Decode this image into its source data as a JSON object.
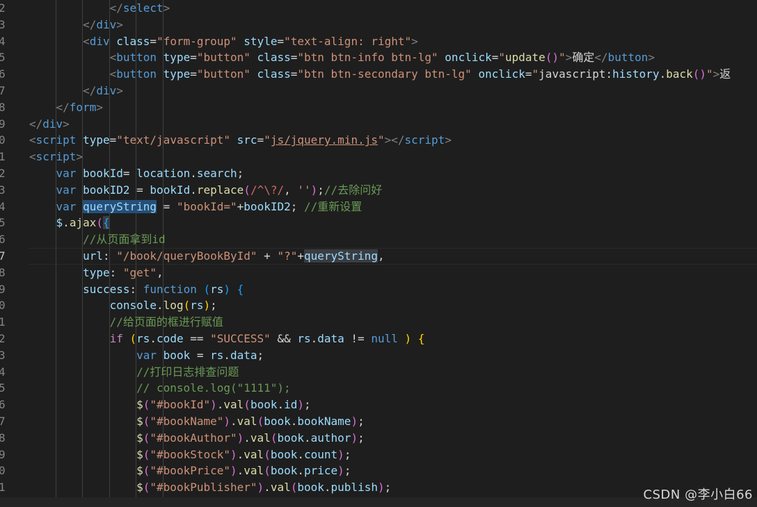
{
  "editor": {
    "theme_colors": {
      "background": "#1e1e1e",
      "tag": "#569cd6",
      "attribute": "#9cdcfe",
      "string": "#ce9178",
      "comment": "#6a9955",
      "function": "#dcdcaa",
      "control": "#c586c0"
    },
    "lines": [
      {
        "n": "2",
        "cls": "",
        "indent": "            ",
        "spans": [
          [
            "punc",
            "</"
          ],
          [
            "tag",
            "select"
          ],
          [
            "punc",
            ">"
          ]
        ]
      },
      {
        "n": "3",
        "cls": "",
        "indent": "        ",
        "spans": [
          [
            "punc",
            "</"
          ],
          [
            "tag",
            "div"
          ],
          [
            "punc",
            ">"
          ]
        ]
      },
      {
        "n": "4",
        "cls": "",
        "indent": "        ",
        "spans": [
          [
            "punc",
            "<"
          ],
          [
            "tag",
            "div"
          ],
          [
            "txt",
            " "
          ],
          [
            "attr",
            "class"
          ],
          [
            "txt",
            "="
          ],
          [
            "str",
            "\"form-group\""
          ],
          [
            "txt",
            " "
          ],
          [
            "attr",
            "style"
          ],
          [
            "txt",
            "="
          ],
          [
            "str",
            "\"text-align: right\""
          ],
          [
            "punc",
            ">"
          ]
        ]
      },
      {
        "n": "5",
        "cls": "",
        "indent": "            ",
        "spans": [
          [
            "punc",
            "<"
          ],
          [
            "tag",
            "button"
          ],
          [
            "txt",
            " "
          ],
          [
            "attr",
            "type"
          ],
          [
            "txt",
            "="
          ],
          [
            "str",
            "\"button\""
          ],
          [
            "txt",
            " "
          ],
          [
            "attr",
            "class"
          ],
          [
            "txt",
            "="
          ],
          [
            "str",
            "\"btn btn-info btn-lg\""
          ],
          [
            "txt",
            " "
          ],
          [
            "attr",
            "onclick"
          ],
          [
            "txt",
            "="
          ],
          [
            "str",
            "\""
          ],
          [
            "fn",
            "update"
          ],
          [
            "paren",
            "()"
          ],
          [
            "str",
            "\""
          ],
          [
            "punc",
            ">"
          ],
          [
            "txt",
            "确定"
          ],
          [
            "punc",
            "</"
          ],
          [
            "tag",
            "button"
          ],
          [
            "punc",
            ">"
          ]
        ]
      },
      {
        "n": "6",
        "cls": "",
        "indent": "            ",
        "spans": [
          [
            "punc",
            "<"
          ],
          [
            "tag",
            "button"
          ],
          [
            "txt",
            " "
          ],
          [
            "attr",
            "type"
          ],
          [
            "txt",
            "="
          ],
          [
            "str",
            "\"button\""
          ],
          [
            "txt",
            " "
          ],
          [
            "attr",
            "class"
          ],
          [
            "txt",
            "="
          ],
          [
            "str",
            "\"btn btn-secondary btn-lg\""
          ],
          [
            "txt",
            " "
          ],
          [
            "attr",
            "onclick"
          ],
          [
            "txt",
            "="
          ],
          [
            "str",
            "\""
          ],
          [
            "txt",
            "javascript:"
          ],
          [
            "var",
            "history"
          ],
          [
            "txt",
            "."
          ],
          [
            "fn",
            "back"
          ],
          [
            "paren",
            "()"
          ],
          [
            "str",
            "\""
          ],
          [
            "punc",
            ">"
          ],
          [
            "txt",
            "返"
          ]
        ]
      },
      {
        "n": "7",
        "cls": "",
        "indent": "        ",
        "spans": [
          [
            "punc",
            "</"
          ],
          [
            "tag",
            "div"
          ],
          [
            "punc",
            ">"
          ]
        ]
      },
      {
        "n": "8",
        "cls": "",
        "indent": "    ",
        "spans": [
          [
            "punc",
            "</"
          ],
          [
            "tag",
            "form"
          ],
          [
            "punc",
            ">"
          ]
        ]
      },
      {
        "n": "9",
        "cls": "",
        "indent": "",
        "spans": [
          [
            "punc",
            "</"
          ],
          [
            "tag",
            "div"
          ],
          [
            "punc",
            ">"
          ]
        ]
      },
      {
        "n": "0",
        "cls": "",
        "indent": "",
        "spans": [
          [
            "punc",
            "<"
          ],
          [
            "tag",
            "script"
          ],
          [
            "txt",
            " "
          ],
          [
            "attr",
            "type"
          ],
          [
            "txt",
            "="
          ],
          [
            "str",
            "\"text/javascript\""
          ],
          [
            "txt",
            " "
          ],
          [
            "attr",
            "src"
          ],
          [
            "txt",
            "="
          ],
          [
            "str",
            "\""
          ],
          [
            "str u",
            "js/jquery.min.js"
          ],
          [
            "str",
            "\""
          ],
          [
            "punc",
            "></"
          ],
          [
            "tag",
            "script"
          ],
          [
            "punc",
            ">"
          ]
        ]
      },
      {
        "n": "1",
        "cls": "",
        "indent": "",
        "spans": [
          [
            "punc",
            "<"
          ],
          [
            "tag",
            "script"
          ],
          [
            "punc",
            ">"
          ]
        ]
      },
      {
        "n": "2",
        "cls": "",
        "indent": "    ",
        "spans": [
          [
            "kw",
            "var"
          ],
          [
            "txt",
            " "
          ],
          [
            "var",
            "bookId"
          ],
          [
            "txt",
            "= "
          ],
          [
            "var",
            "location"
          ],
          [
            "txt",
            "."
          ],
          [
            "var",
            "search"
          ],
          [
            "txt",
            ";"
          ]
        ]
      },
      {
        "n": "3",
        "cls": "",
        "indent": "    ",
        "spans": [
          [
            "kw",
            "var"
          ],
          [
            "txt",
            " "
          ],
          [
            "var",
            "bookID2"
          ],
          [
            "txt",
            " = "
          ],
          [
            "var",
            "bookId"
          ],
          [
            "txt",
            "."
          ],
          [
            "fn",
            "replace"
          ],
          [
            "paren",
            "("
          ],
          [
            "rx",
            "/^\\?/"
          ],
          [
            "txt",
            ", "
          ],
          [
            "str",
            "''"
          ],
          [
            "paren",
            ")"
          ],
          [
            "txt",
            ";"
          ],
          [
            "cmt",
            "//去除问好"
          ]
        ]
      },
      {
        "n": "4",
        "cls": "",
        "indent": "    ",
        "spans": [
          [
            "kw",
            "var"
          ],
          [
            "txt",
            " "
          ],
          [
            "var hl-word",
            "queryString"
          ],
          [
            "txt",
            " = "
          ],
          [
            "str",
            "\"bookId=\""
          ],
          [
            "txt",
            "+"
          ],
          [
            "var",
            "bookID2"
          ],
          [
            "txt",
            "; "
          ],
          [
            "cmt",
            "//重新设置"
          ]
        ]
      },
      {
        "n": "5",
        "cls": "",
        "indent": "    ",
        "spans": [
          [
            "var",
            "$"
          ],
          [
            "txt",
            "."
          ],
          [
            "fn",
            "ajax"
          ],
          [
            "paren",
            "("
          ],
          [
            "brace2 hl-soft",
            "{"
          ]
        ]
      },
      {
        "n": "6",
        "cls": "",
        "indent": "        ",
        "spans": [
          [
            "cmt",
            "//从页面拿到id"
          ]
        ]
      },
      {
        "n": "7",
        "cls": "current",
        "indent": "        ",
        "spans": [
          [
            "var",
            "url"
          ],
          [
            "txt",
            ": "
          ],
          [
            "str",
            "\"/book/queryBookById\""
          ],
          [
            "txt",
            " + "
          ],
          [
            "str",
            "\"?\""
          ],
          [
            "txt",
            "+"
          ],
          [
            "var hl-soft",
            "queryString"
          ],
          [
            "txt",
            ","
          ]
        ]
      },
      {
        "n": "8",
        "cls": "",
        "indent": "        ",
        "spans": [
          [
            "var",
            "type"
          ],
          [
            "txt",
            ": "
          ],
          [
            "str",
            "\"get\""
          ],
          [
            "txt",
            ","
          ]
        ]
      },
      {
        "n": "9",
        "cls": "",
        "indent": "        ",
        "spans": [
          [
            "var",
            "success"
          ],
          [
            "txt",
            ": "
          ],
          [
            "kw",
            "function"
          ],
          [
            "txt",
            " "
          ],
          [
            "brace2",
            "("
          ],
          [
            "var",
            "rs"
          ],
          [
            "brace2",
            ")"
          ],
          [
            "txt",
            " "
          ],
          [
            "brace2",
            "{"
          ]
        ]
      },
      {
        "n": "0",
        "cls": "",
        "indent": "            ",
        "spans": [
          [
            "var",
            "console"
          ],
          [
            "txt",
            "."
          ],
          [
            "fn",
            "log"
          ],
          [
            "brace",
            "("
          ],
          [
            "var",
            "rs"
          ],
          [
            "brace",
            ")"
          ],
          [
            "txt",
            ";"
          ]
        ]
      },
      {
        "n": "1",
        "cls": "",
        "indent": "            ",
        "spans": [
          [
            "cmt",
            "//给页面的框进行赋值"
          ]
        ]
      },
      {
        "n": "2",
        "cls": "",
        "indent": "            ",
        "spans": [
          [
            "ctl",
            "if"
          ],
          [
            "txt",
            " "
          ],
          [
            "brace",
            "("
          ],
          [
            "var",
            "rs"
          ],
          [
            "txt",
            "."
          ],
          [
            "var",
            "code"
          ],
          [
            "txt",
            " == "
          ],
          [
            "str",
            "\"SUCCESS\""
          ],
          [
            "txt",
            " && "
          ],
          [
            "var",
            "rs"
          ],
          [
            "txt",
            "."
          ],
          [
            "var",
            "data"
          ],
          [
            "txt",
            " != "
          ],
          [
            "kw",
            "null"
          ],
          [
            "txt",
            " "
          ],
          [
            "brace",
            ")"
          ],
          [
            "txt",
            " "
          ],
          [
            "brace",
            "{"
          ]
        ]
      },
      {
        "n": "3",
        "cls": "",
        "indent": "                ",
        "spans": [
          [
            "kw",
            "var"
          ],
          [
            "txt",
            " "
          ],
          [
            "var",
            "book"
          ],
          [
            "txt",
            " = "
          ],
          [
            "var",
            "rs"
          ],
          [
            "txt",
            "."
          ],
          [
            "var",
            "data"
          ],
          [
            "txt",
            ";"
          ]
        ]
      },
      {
        "n": "4",
        "cls": "",
        "indent": "                ",
        "spans": [
          [
            "cmt",
            "//打印日志排查问题"
          ]
        ]
      },
      {
        "n": "5",
        "cls": "",
        "indent": "                ",
        "spans": [
          [
            "cmt",
            "// console.log(\"1111\");"
          ]
        ]
      },
      {
        "n": "6",
        "cls": "",
        "indent": "                ",
        "spans": [
          [
            "fn",
            "$"
          ],
          [
            "paren",
            "("
          ],
          [
            "str",
            "\"#bookId\""
          ],
          [
            "paren",
            ")"
          ],
          [
            "txt",
            "."
          ],
          [
            "fn",
            "val"
          ],
          [
            "paren",
            "("
          ],
          [
            "var",
            "book"
          ],
          [
            "txt",
            "."
          ],
          [
            "var",
            "id"
          ],
          [
            "paren",
            ")"
          ],
          [
            "txt",
            ";"
          ]
        ]
      },
      {
        "n": "7",
        "cls": "",
        "indent": "                ",
        "spans": [
          [
            "fn",
            "$"
          ],
          [
            "paren",
            "("
          ],
          [
            "str",
            "\"#bookName\""
          ],
          [
            "paren",
            ")"
          ],
          [
            "txt",
            "."
          ],
          [
            "fn",
            "val"
          ],
          [
            "paren",
            "("
          ],
          [
            "var",
            "book"
          ],
          [
            "txt",
            "."
          ],
          [
            "var",
            "bookName"
          ],
          [
            "paren",
            ")"
          ],
          [
            "txt",
            ";"
          ]
        ]
      },
      {
        "n": "8",
        "cls": "",
        "indent": "                ",
        "spans": [
          [
            "fn",
            "$"
          ],
          [
            "paren",
            "("
          ],
          [
            "str",
            "\"#bookAuthor\""
          ],
          [
            "paren",
            ")"
          ],
          [
            "txt",
            "."
          ],
          [
            "fn",
            "val"
          ],
          [
            "paren",
            "("
          ],
          [
            "var",
            "book"
          ],
          [
            "txt",
            "."
          ],
          [
            "var",
            "author"
          ],
          [
            "paren",
            ")"
          ],
          [
            "txt",
            ";"
          ]
        ]
      },
      {
        "n": "9",
        "cls": "",
        "indent": "                ",
        "spans": [
          [
            "fn",
            "$"
          ],
          [
            "paren",
            "("
          ],
          [
            "str",
            "\"#bookStock\""
          ],
          [
            "paren",
            ")"
          ],
          [
            "txt",
            "."
          ],
          [
            "fn",
            "val"
          ],
          [
            "paren",
            "("
          ],
          [
            "var",
            "book"
          ],
          [
            "txt",
            "."
          ],
          [
            "var",
            "count"
          ],
          [
            "paren",
            ")"
          ],
          [
            "txt",
            ";"
          ]
        ]
      },
      {
        "n": "0",
        "cls": "",
        "indent": "                ",
        "spans": [
          [
            "fn",
            "$"
          ],
          [
            "paren",
            "("
          ],
          [
            "str",
            "\"#bookPrice\""
          ],
          [
            "paren",
            ")"
          ],
          [
            "txt",
            "."
          ],
          [
            "fn",
            "val"
          ],
          [
            "paren",
            "("
          ],
          [
            "var",
            "book"
          ],
          [
            "txt",
            "."
          ],
          [
            "var",
            "price"
          ],
          [
            "paren",
            ")"
          ],
          [
            "txt",
            ";"
          ]
        ]
      },
      {
        "n": "1",
        "cls": "",
        "indent": "                ",
        "spans": [
          [
            "fn",
            "$"
          ],
          [
            "paren",
            "("
          ],
          [
            "str",
            "\"#bookPublisher\""
          ],
          [
            "paren",
            ")"
          ],
          [
            "txt",
            "."
          ],
          [
            "fn",
            "val"
          ],
          [
            "paren",
            "("
          ],
          [
            "var",
            "book"
          ],
          [
            "txt",
            "."
          ],
          [
            "var",
            "publish"
          ],
          [
            "paren",
            ")"
          ],
          [
            "txt",
            ";"
          ]
        ]
      }
    ]
  },
  "watermark": "CSDN @李小白66"
}
